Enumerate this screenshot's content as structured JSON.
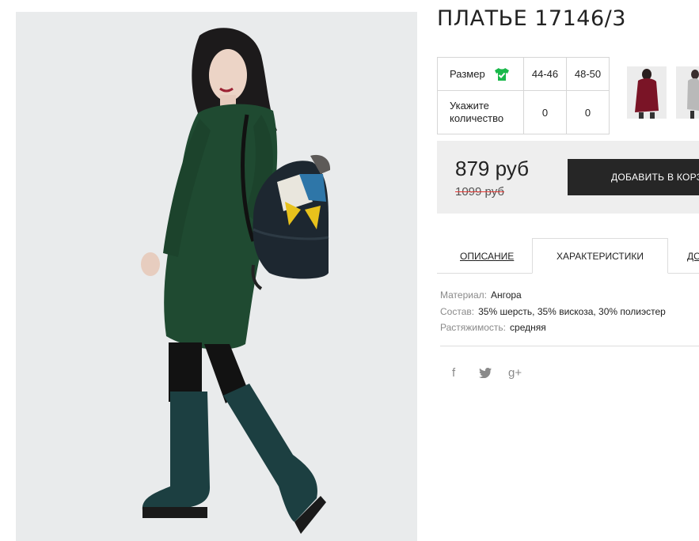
{
  "product": {
    "title": "ПЛАТЬЕ 17146/3",
    "size_label": "Размер",
    "sizes": [
      "44-46",
      "48-50"
    ],
    "quantity_label": [
      "Укажите",
      "количество"
    ],
    "quantities": [
      "0",
      "0"
    ]
  },
  "price": {
    "current": "879 руб",
    "old": "1099 руб",
    "add_to_cart": "ДОБАВИТЬ В КОРЗИНУ"
  },
  "tabs": {
    "description": "ОПИСАНИЕ",
    "characteristics": "ХАРАКТЕРИСТИКИ",
    "more": "ДО"
  },
  "specs": [
    {
      "key": "Материал:",
      "value": "Ангора"
    },
    {
      "key": "Состав:",
      "value": "35% шерсть, 35% вискоза, 30% полиэстер"
    },
    {
      "key": "Растяжимость:",
      "value": "средняя"
    }
  ],
  "social": {
    "facebook": "f",
    "googleplus": "g+"
  },
  "icons": {
    "size_chart": "tshirt-check-icon",
    "cart": "shopping-bag-icon",
    "share": [
      "facebook-icon",
      "twitter-icon",
      "google-plus-icon"
    ]
  },
  "colors": {
    "dress": "#1f4a31",
    "size_check": "#19b84a",
    "old_price_strike": "#e53935",
    "button_bg": "#262626",
    "price_panel": "#eeeeee",
    "thumb_dress_1": "#7a1426",
    "thumb_dress_2": "#b9b9b9"
  }
}
